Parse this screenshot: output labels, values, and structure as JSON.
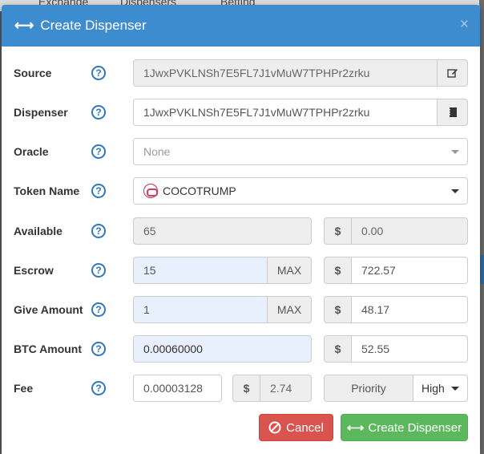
{
  "background": {
    "nav_items": [
      "Exchange",
      "Dispensers",
      "Betting"
    ]
  },
  "modal": {
    "title": "Create Dispenser",
    "title_icon": "exchange-arrows-icon",
    "close_label": "×"
  },
  "form": {
    "source": {
      "label": "Source",
      "help": "?",
      "value": "1JwxPVKLNSh7E5FL7J1vMuW7TPHPr2zrku",
      "icon": "edit-icon"
    },
    "dispenser": {
      "label": "Dispenser",
      "help": "?",
      "value": "1JwxPVKLNSh7E5FL7J1vMuW7TPHPr2zrku",
      "icon": "address-book-icon"
    },
    "oracle": {
      "label": "Oracle",
      "help": "?",
      "value": "None"
    },
    "token_name": {
      "label": "Token Name",
      "help": "?",
      "value": "COCOTRUMP",
      "icon": "token-icon"
    },
    "available": {
      "label": "Available",
      "help": "?",
      "value": "65",
      "currency": "$",
      "usd": "0.00"
    },
    "escrow": {
      "label": "Escrow",
      "help": "?",
      "value": "15",
      "max_label": "MAX",
      "currency": "$",
      "usd": "722.57"
    },
    "give_amount": {
      "label": "Give Amount",
      "help": "?",
      "value": "1",
      "max_label": "MAX",
      "currency": "$",
      "usd": "48.17"
    },
    "btc_amount": {
      "label": "BTC Amount",
      "help": "?",
      "value": "0.00060000",
      "currency": "$",
      "usd": "52.55"
    },
    "fee": {
      "label": "Fee",
      "help": "?",
      "value": "0.00003128",
      "currency": "$",
      "usd": "2.74",
      "priority_label": "Priority",
      "priority_value": "High"
    }
  },
  "buttons": {
    "cancel": "Cancel",
    "create": "Create Dispenser"
  },
  "colors": {
    "header": "#3d8ccf",
    "cancel": "#d9534f",
    "create": "#5cb85c",
    "highlight_input": "#e8f0fe"
  }
}
